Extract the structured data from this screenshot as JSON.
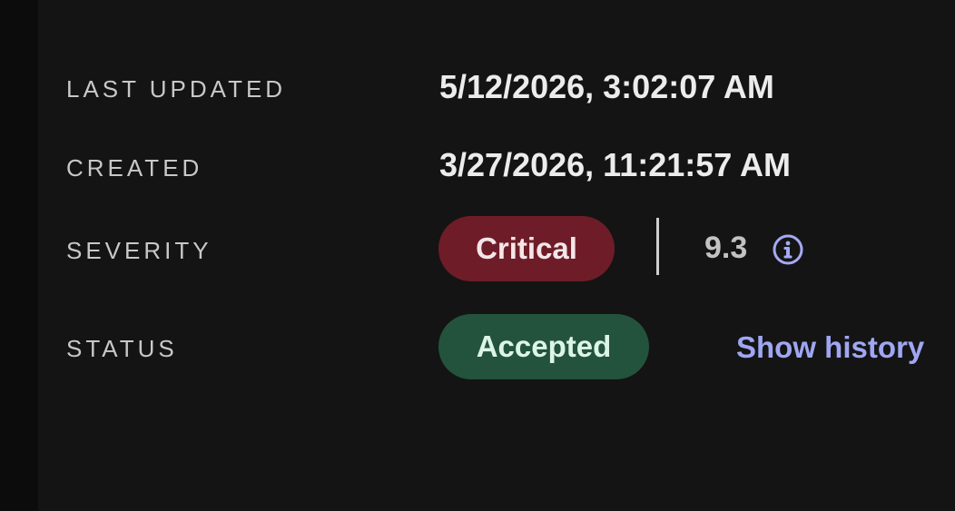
{
  "details": {
    "last_updated": {
      "label": "LAST UPDATED",
      "value": "5/12/2026, 3:02:07 AM"
    },
    "created": {
      "label": "CREATED",
      "value": "3/27/2026, 11:21:57 AM"
    },
    "severity": {
      "label": "SEVERITY",
      "badge": "Critical",
      "score": "9.3",
      "icon": "info-icon",
      "badge_color": "#6e1d28"
    },
    "status": {
      "label": "STATUS",
      "badge": "Accepted",
      "link": "Show history",
      "badge_color": "#23533d",
      "link_color": "#9fa6f2"
    }
  }
}
